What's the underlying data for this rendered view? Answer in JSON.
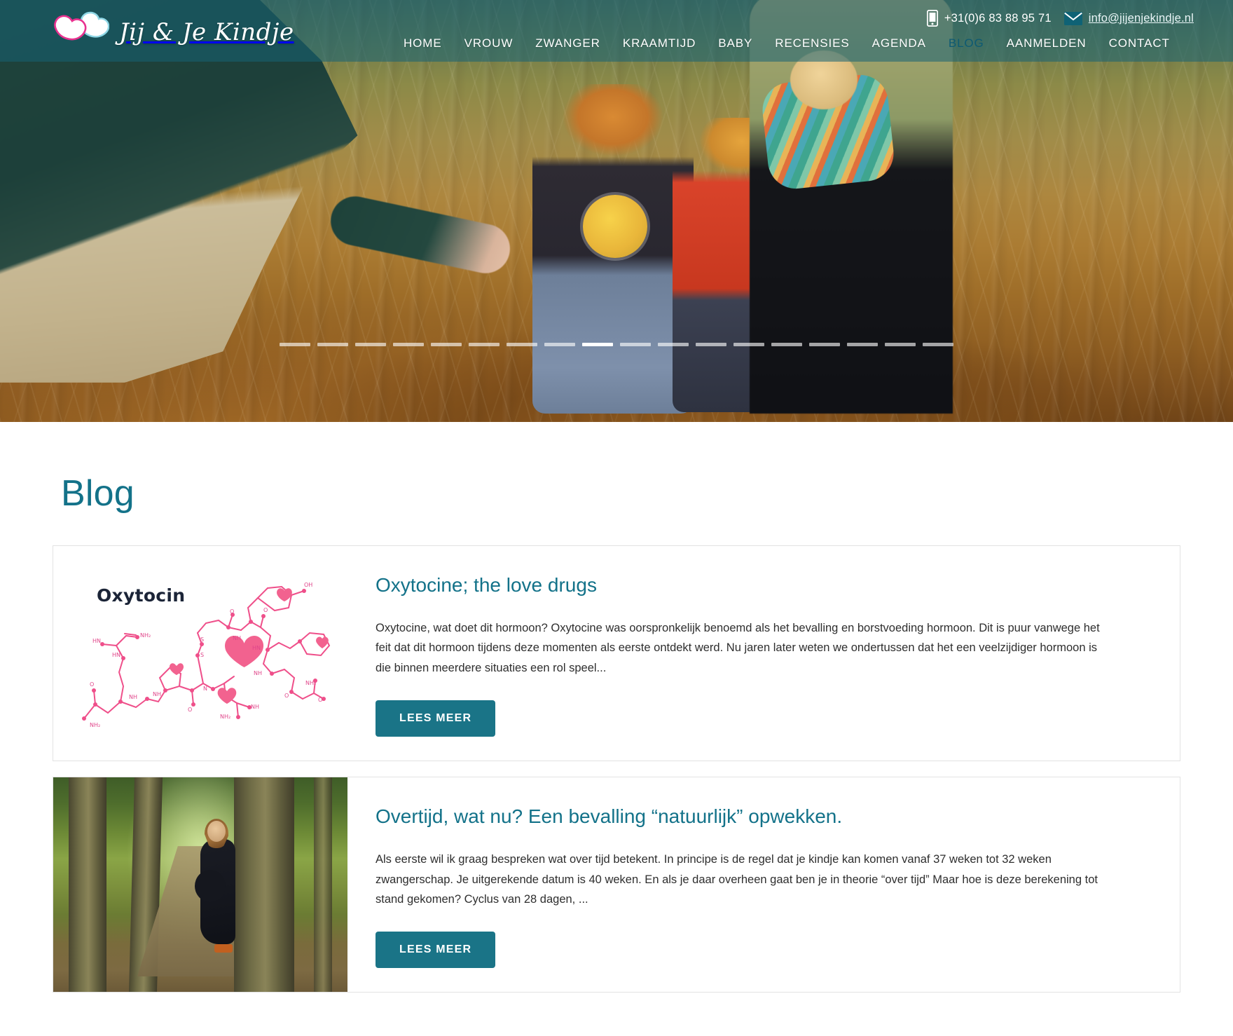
{
  "site": {
    "brand_name": "Jij & Je Kindje",
    "logo_icon": "two-hearts-icon"
  },
  "topbar": {
    "phone_icon": "mobile-phone-icon",
    "phone": "+31(0)6 83 88 95 71",
    "mail_icon": "envelope-icon",
    "email": "info@jijenjekindje.nl"
  },
  "nav": {
    "items": [
      {
        "label": "HOME",
        "active": false
      },
      {
        "label": "VROUW",
        "active": false
      },
      {
        "label": "ZWANGER",
        "active": false
      },
      {
        "label": "KRAAMTIJD",
        "active": false
      },
      {
        "label": "BABY",
        "active": false
      },
      {
        "label": "RECENSIES",
        "active": false
      },
      {
        "label": "AGENDA",
        "active": false
      },
      {
        "label": "BLOG",
        "active": true
      },
      {
        "label": "AANMELDEN",
        "active": false
      },
      {
        "label": "CONTACT",
        "active": false
      }
    ]
  },
  "hero": {
    "slider_dash_count": 18,
    "slider_active_index": 8
  },
  "colors": {
    "teal": "#137289",
    "button_teal": "#1a7487",
    "nav_active": "#0d5a73",
    "topbar_overlay": "#156374"
  },
  "main": {
    "page_title": "Blog",
    "posts": [
      {
        "thumb_kind": "oxytocin-molecule",
        "thumb_caption": "Oxytocin",
        "title": "Oxytocine; the love drugs",
        "excerpt": "Oxytocine, wat doet dit hormoon?   Oxytocine was oorspronkelijk benoemd als het bevalling en borstvoeding hormoon. Dit is puur vanwege het feit dat dit hormoon tijdens deze momenten als eerste ontdekt werd. Nu jaren later weten we ondertussen dat het een veelzijdiger hormoon is die binnen meerdere situaties een rol speel...",
        "button_label": "LEES MEER"
      },
      {
        "thumb_kind": "pregnant-woman-woods-photo",
        "thumb_caption": "",
        "title": "Overtijd, wat nu? Een bevalling “natuurlijk” opwekken.",
        "excerpt": "Als eerste wil ik graag bespreken wat over tijd betekent. In principe is de regel dat je kindje kan komen vanaf 37 weken tot 32 weken zwangerschap. Je uitgerekende datum is 40 weken. En als je daar overheen  gaat ben je in theorie “over tijd” Maar hoe is deze berekening tot stand gekomen? Cyclus van 28 dagen, ...",
        "button_label": "LEES MEER"
      }
    ]
  }
}
